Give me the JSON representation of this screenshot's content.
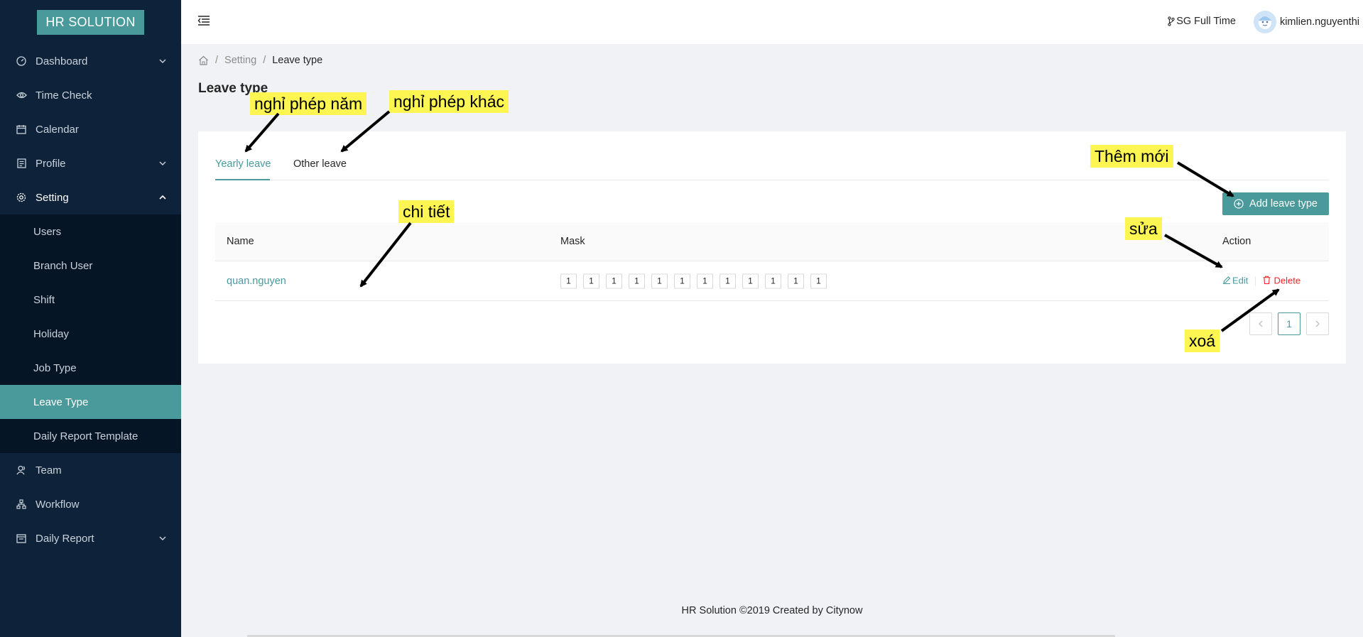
{
  "sidebar": {
    "logo": "HR SOLUTION",
    "items": [
      {
        "label": "Dashboard"
      },
      {
        "label": "Time Check"
      },
      {
        "label": "Calendar"
      },
      {
        "label": "Profile"
      },
      {
        "label": "Setting"
      }
    ],
    "setting_children": [
      {
        "label": "Users"
      },
      {
        "label": "Branch User"
      },
      {
        "label": "Shift"
      },
      {
        "label": "Holiday"
      },
      {
        "label": "Job Type"
      },
      {
        "label": "Leave Type"
      },
      {
        "label": "Daily Report Template"
      }
    ],
    "bottom_items": [
      {
        "label": "Team"
      },
      {
        "label": "Workflow"
      },
      {
        "label": "Daily Report"
      }
    ],
    "active_item": "Leave Type"
  },
  "header": {
    "shift": "SG Full Time",
    "username": "kimlien.nguyenthi"
  },
  "breadcrumb": {
    "items": [
      "Setting",
      "Leave type"
    ]
  },
  "page": {
    "title": "Leave type",
    "tabs": [
      "Yearly leave",
      "Other leave"
    ],
    "active_tab": "Yearly leave",
    "add_button": "Add leave type"
  },
  "table": {
    "columns": [
      "Name",
      "Mask",
      "Action"
    ],
    "rows": [
      {
        "name": "quan.nguyen",
        "mask": [
          "1",
          "1",
          "1",
          "1",
          "1",
          "1",
          "1",
          "1",
          "1",
          "1",
          "1",
          "1"
        ],
        "edit": "Edit",
        "delete": "Delete"
      }
    ]
  },
  "pagination": {
    "current": "1",
    "prev": "<",
    "next": ">"
  },
  "footer": "HR Solution ©2019 Created by Citynow",
  "annotations": {
    "yearly": "nghỉ phép năm",
    "other": "nghỉ phép khác",
    "add": "Thêm mới",
    "detail": "chi tiết",
    "edit": "sửa",
    "delete": "xoá"
  },
  "colors": {
    "sidebar_bg": "#0e2339",
    "accent": "#4a9a9c",
    "danger": "#f5222d",
    "annotation": "#fcf552"
  }
}
